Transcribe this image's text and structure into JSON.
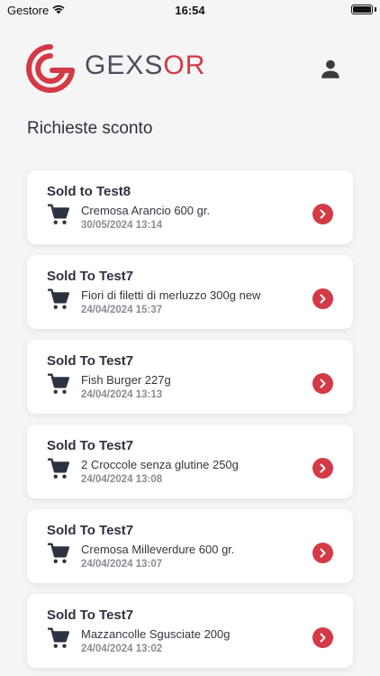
{
  "status_bar": {
    "carrier": "Gestore",
    "time": "16:54"
  },
  "header": {
    "logo_text_main": "GEXS",
    "logo_text_accent": "OR",
    "brand_color": "#d33a46",
    "user_icon": "user-icon"
  },
  "page": {
    "title": "Richieste sconto"
  },
  "requests": [
    {
      "title": "Sold to Test8",
      "product": "Cremosa Arancio 600 gr.",
      "date": "30/05/2024 13:14"
    },
    {
      "title": "Sold To Test7",
      "product": "Fiori di filetti di merluzzo 300g new",
      "date": "24/04/2024 15:37"
    },
    {
      "title": "Sold To Test7",
      "product": "Fish Burger 227g",
      "date": "24/04/2024 13:13"
    },
    {
      "title": "Sold To Test7",
      "product": "2 Croccole senza glutine 250g",
      "date": "24/04/2024 13:08"
    },
    {
      "title": "Sold To Test7",
      "product": "Cremosa Milleverdure 600 gr.",
      "date": "24/04/2024 13:07"
    },
    {
      "title": "Sold To Test7",
      "product": "Mazzancolle Sgusciate 200g",
      "date": "24/04/2024 13:02"
    }
  ]
}
